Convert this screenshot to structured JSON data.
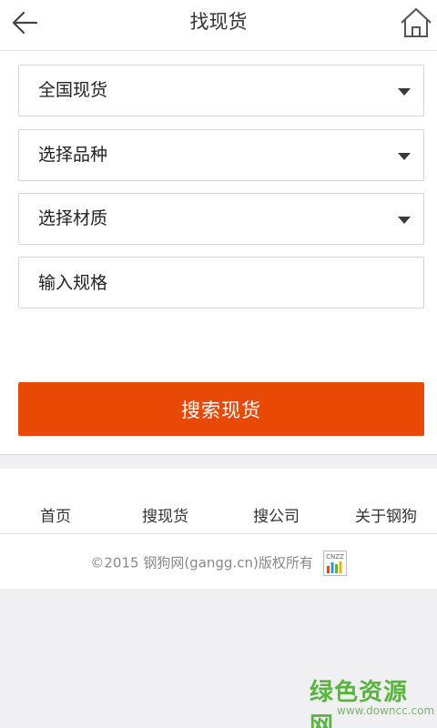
{
  "header": {
    "title": "找现货",
    "back_icon": "back-arrow-icon",
    "home_icon": "home-icon"
  },
  "form": {
    "region": {
      "label": "全国现货"
    },
    "variety": {
      "label": "选择品种"
    },
    "material": {
      "label": "选择材质"
    },
    "spec": {
      "placeholder": "输入规格",
      "value": ""
    },
    "search_label": "搜索现货"
  },
  "footer": {
    "nav": [
      {
        "label": "首页"
      },
      {
        "label": "搜现货"
      },
      {
        "label": "搜公司"
      },
      {
        "label": "关于钢狗"
      }
    ],
    "copyright": "©2015 钢狗网(gangg.cn)版权所有",
    "stat_badge": "CNZZ"
  },
  "watermark": {
    "main": "绿色资源网",
    "sub": "www.downcc.com"
  },
  "colors": {
    "accent": "#e84a06",
    "background": "#f0f0f2",
    "watermark": "#5ab440"
  }
}
